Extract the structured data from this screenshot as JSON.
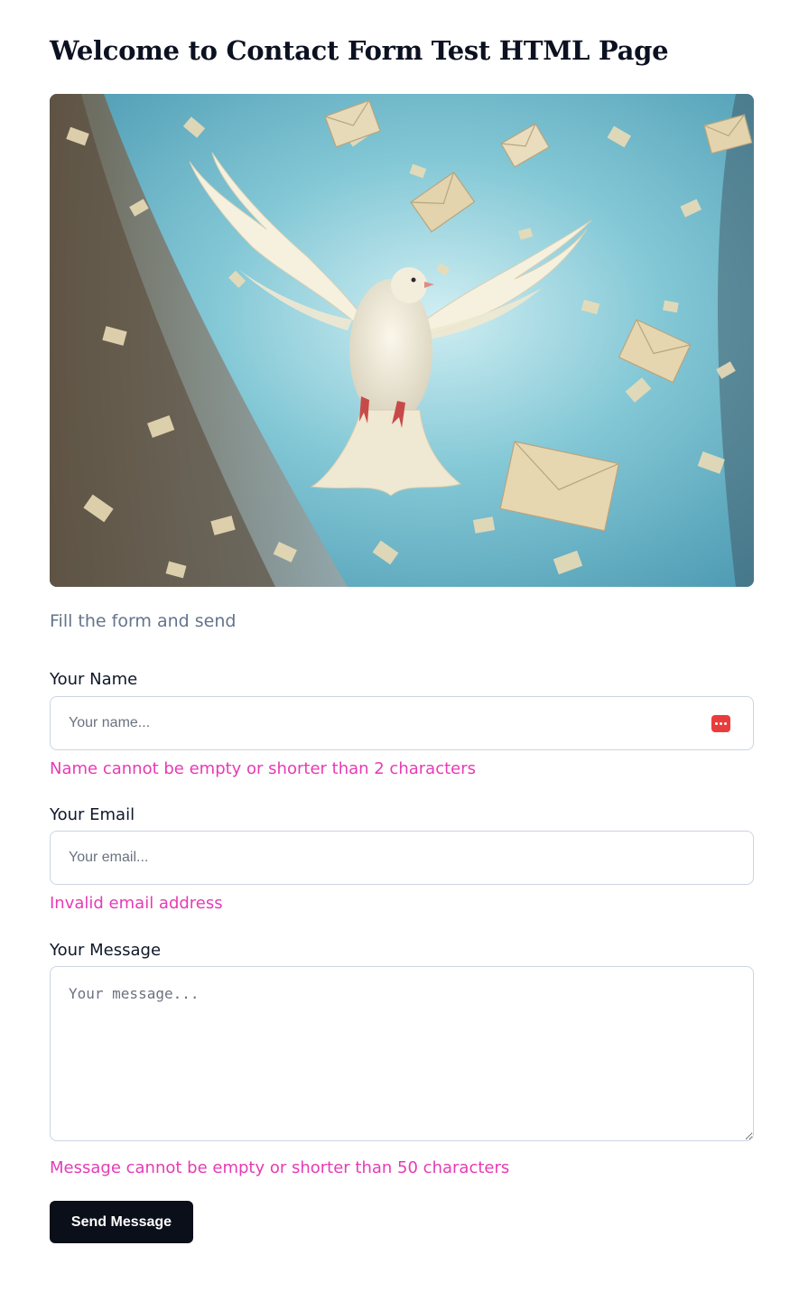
{
  "page": {
    "title": "Welcome to Contact Form Test HTML Page",
    "subtitle": "Fill the form and send"
  },
  "hero": {
    "icon": "dove-with-envelopes-image"
  },
  "form": {
    "name": {
      "label": "Your Name",
      "value": "",
      "placeholder": "Your name...",
      "error": "Name cannot be empty or shorter than 2 characters",
      "autofill_icon": "password-manager-icon"
    },
    "email": {
      "label": "Your Email",
      "value": "",
      "placeholder": "Your email...",
      "error": "Invalid email address"
    },
    "message": {
      "label": "Your Message",
      "value": "",
      "placeholder": "Your message...",
      "error": "Message cannot be empty or shorter than 50 characters"
    },
    "submit_label": "Send Message"
  },
  "colors": {
    "error": "#e63bb4",
    "button": "#0b0f1a",
    "subtitle": "#64748b",
    "autofill_icon": "#ea3c3c"
  }
}
